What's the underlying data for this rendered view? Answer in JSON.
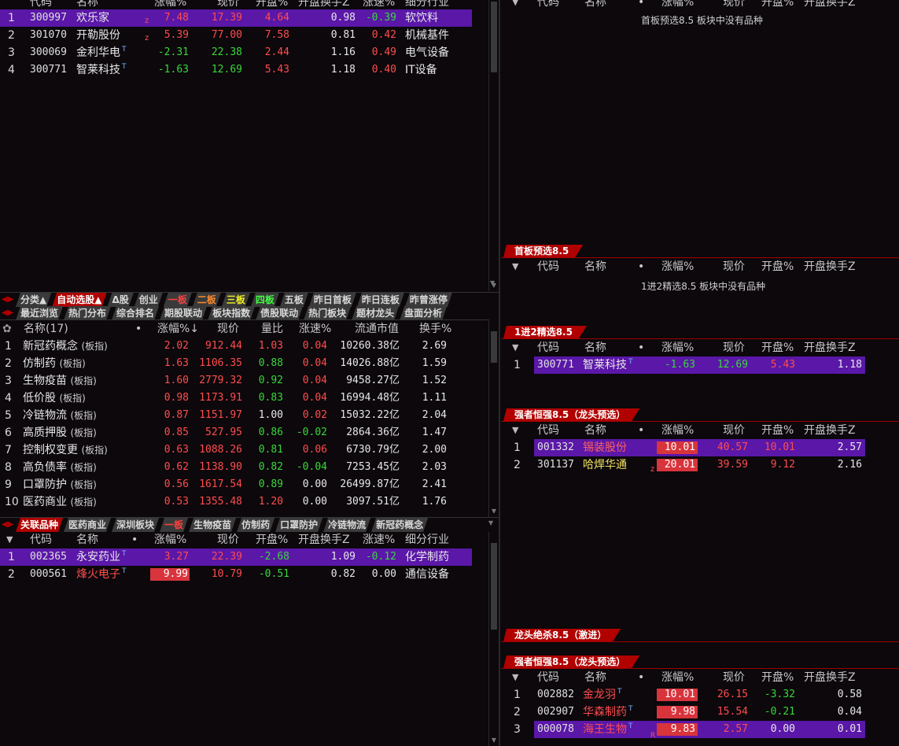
{
  "top_table": {
    "headers": [
      "代码",
      "名称",
      "涨幅%",
      "现价",
      "开盘%",
      "开盘换手Z",
      "涨速%",
      "细分行业"
    ],
    "rows": [
      {
        "idx": "1",
        "code": "300997",
        "name": "欢乐家",
        "mark": "z",
        "chg": "7.48",
        "price": "17.39",
        "open": "4.64",
        "turn": "0.98",
        "speed": "-0.39",
        "ind": "软饮料"
      },
      {
        "idx": "2",
        "code": "301070",
        "name": "开勒股份",
        "mark": "z",
        "chg": "5.39",
        "price": "77.00",
        "open": "7.58",
        "turn": "0.81",
        "speed": "0.42",
        "ind": "机械基件"
      },
      {
        "idx": "3",
        "code": "300069",
        "name": "金利华电",
        "mark": "T",
        "chg": "-2.31",
        "price": "22.38",
        "open": "2.44",
        "turn": "1.16",
        "speed": "0.49",
        "ind": "电气设备"
      },
      {
        "idx": "4",
        "code": "300771",
        "name": "智莱科技",
        "mark": "T",
        "chg": "-1.63",
        "price": "12.69",
        "open": "5.43",
        "turn": "1.18",
        "speed": "0.40",
        "ind": "IT设备"
      }
    ]
  },
  "tabs1": [
    "分类▲",
    "自动选股▲",
    "Δ股",
    "创业",
    "一板",
    "二板",
    "三板",
    "四板",
    "五板",
    "昨日首板",
    "昨日连板",
    "昨曾涨停"
  ],
  "tabs2": [
    "最近浏览",
    "热门分布",
    "综合排名",
    "期股联动",
    "板块指数",
    "债股联动",
    "热门板块",
    "题材龙头",
    "盘面分析"
  ],
  "sector_table": {
    "headers": [
      "名称(17)",
      "•",
      "涨幅%↓",
      "现价",
      "量比",
      "涨速%",
      "流通市值",
      "换手%"
    ],
    "tag": "(板指)",
    "rows": [
      {
        "idx": "1",
        "name": "新冠药概念",
        "chg": "2.02",
        "price": "912.44",
        "vr": "1.03",
        "speed": "0.04",
        "cap": "10260.38亿",
        "turn": "2.69"
      },
      {
        "idx": "2",
        "name": "仿制药",
        "chg": "1.63",
        "price": "1106.35",
        "vr": "0.88",
        "speed": "0.04",
        "cap": "14026.88亿",
        "turn": "1.59"
      },
      {
        "idx": "3",
        "name": "生物疫苗",
        "chg": "1.60",
        "price": "2779.32",
        "vr": "0.92",
        "speed": "0.04",
        "cap": "9458.27亿",
        "turn": "1.52"
      },
      {
        "idx": "4",
        "name": "低价股",
        "chg": "0.98",
        "price": "1173.91",
        "vr": "0.83",
        "speed": "0.04",
        "cap": "16994.48亿",
        "turn": "1.11"
      },
      {
        "idx": "5",
        "name": "冷链物流",
        "chg": "0.87",
        "price": "1151.97",
        "vr": "1.00",
        "speed": "0.02",
        "cap": "15032.22亿",
        "turn": "2.04"
      },
      {
        "idx": "6",
        "name": "高质押股",
        "chg": "0.85",
        "price": "527.95",
        "vr": "0.86",
        "speed": "-0.02",
        "cap": "2864.36亿",
        "turn": "1.47"
      },
      {
        "idx": "7",
        "name": "控制权变更",
        "chg": "0.63",
        "price": "1088.26",
        "vr": "0.81",
        "speed": "0.06",
        "cap": "6730.79亿",
        "turn": "2.00"
      },
      {
        "idx": "8",
        "name": "高负债率",
        "chg": "0.62",
        "price": "1138.90",
        "vr": "0.82",
        "speed": "-0.04",
        "cap": "7253.45亿",
        "turn": "2.03"
      },
      {
        "idx": "9",
        "name": "口罩防护",
        "chg": "0.56",
        "price": "1617.54",
        "vr": "0.89",
        "speed": "0.00",
        "cap": "26499.87亿",
        "turn": "2.41"
      },
      {
        "idx": "10",
        "name": "医药商业",
        "chg": "0.53",
        "price": "1355.48",
        "vr": "1.20",
        "speed": "0.00",
        "cap": "3097.51亿",
        "turn": "1.76"
      }
    ]
  },
  "tabs3": [
    "关联品种",
    "医药商业",
    "深圳板块",
    "一板",
    "生物疫苗",
    "仿制药",
    "口罩防护",
    "冷链物流",
    "新冠药概念"
  ],
  "related_table": {
    "headers": [
      "代码",
      "名称",
      "•",
      "涨幅%",
      "现价",
      "开盘%",
      "开盘换手Z",
      "涨速%",
      "细分行业"
    ],
    "rows": [
      {
        "idx": "1",
        "code": "002365",
        "name": "永安药业",
        "mark": "T",
        "chg": "3.27",
        "price": "22.39",
        "open": "-2.68",
        "turn": "1.09",
        "speed": "-0.12",
        "ind": "化学制药"
      },
      {
        "idx": "2",
        "code": "000561",
        "name": "烽火电子",
        "mark": "T",
        "chg": "9.99",
        "price": "10.79",
        "open": "-0.51",
        "turn": "0.82",
        "speed": "0.00",
        "ind": "通信设备"
      }
    ]
  },
  "right": {
    "headers": [
      "代码",
      "名称",
      "•",
      "涨幅%",
      "现价",
      "开盘%",
      "开盘换手Z"
    ],
    "p1": {
      "empty": "首板预选8.5 板块中没有品种"
    },
    "p2": {
      "label": "首板预选8.5",
      "empty": "1进2精选8.5 板块中没有品种"
    },
    "p3": {
      "label": "1进2精选8.5",
      "rows": [
        {
          "idx": "1",
          "code": "300771",
          "name": "智莱科技",
          "mark": "T",
          "chg": "-1.63",
          "price": "12.69",
          "open": "5.43",
          "turn": "1.18"
        }
      ]
    },
    "p4": {
      "label": "强者恒强8.5（龙头预选）",
      "rows": [
        {
          "idx": "1",
          "code": "001332",
          "name": "锡装股份",
          "mark": "",
          "chg": "10.01",
          "price": "40.57",
          "open": "10.01",
          "turn": "2.57"
        },
        {
          "idx": "2",
          "code": "301137",
          "name": "哈焊华通",
          "mark": "z",
          "chg": "20.01",
          "price": "39.59",
          "open": "9.12",
          "turn": "2.16"
        }
      ]
    },
    "p5": {
      "label": "龙头绝杀8.5（激进）"
    },
    "p6": {
      "label": "强者恒强8.5（龙头预选）",
      "rows": [
        {
          "idx": "1",
          "code": "002882",
          "name": "金龙羽",
          "mark": "T",
          "chg": "10.01",
          "price": "26.15",
          "open": "-3.32",
          "turn": "0.58"
        },
        {
          "idx": "2",
          "code": "002907",
          "name": "华森制药",
          "mark": "T",
          "chg": "9.98",
          "price": "15.54",
          "open": "-0.21",
          "turn": "0.04"
        },
        {
          "idx": "3",
          "code": "000078",
          "name": "海王生物",
          "mark": "T",
          "mark2": "R",
          "chg": "9.83",
          "price": "2.57",
          "open": "0.00",
          "turn": "0.01"
        }
      ]
    }
  }
}
